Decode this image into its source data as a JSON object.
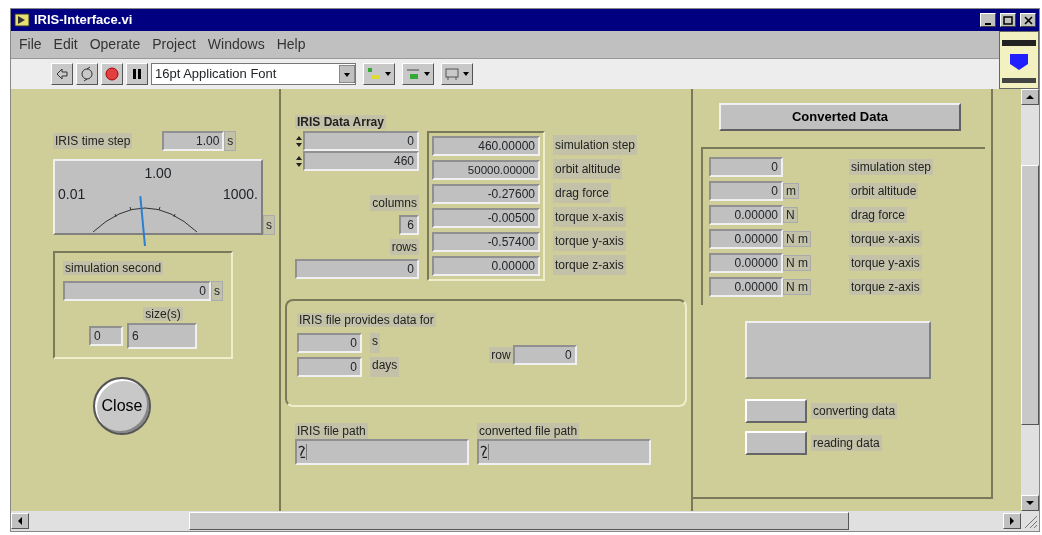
{
  "window": {
    "title": "IRIS-Interface.vi"
  },
  "menu": [
    "File",
    "Edit",
    "Operate",
    "Project",
    "Windows",
    "Help"
  ],
  "toolbar": {
    "font": "16pt Application Font"
  },
  "time_step": {
    "label": "IRIS time step",
    "value": "1.00",
    "unit": "s"
  },
  "meter": {
    "min": "0.01",
    "mid": "1.00",
    "max": "1000.",
    "unit": "s",
    "level": 0.47
  },
  "simulation_second": {
    "label": "simulation second",
    "value": "0",
    "unit": "s",
    "size_label": "size(s)",
    "index": "0",
    "size": "6"
  },
  "close_button": "Close",
  "data_array": {
    "label": "IRIS Data Array",
    "indices": [
      "0",
      "460"
    ],
    "columns_label": "columns",
    "columns": "6",
    "rows_label": "rows",
    "rows": "0",
    "elements": [
      {
        "value": "460.00000",
        "label": "simulation step"
      },
      {
        "value": "50000.00000",
        "label": "orbit altitude"
      },
      {
        "value": "-0.27600",
        "label": "drag force"
      },
      {
        "value": "-0.00500",
        "label": "torque x-axis"
      },
      {
        "value": "-0.57400",
        "label": "torque y-axis"
      },
      {
        "value": "0.00000",
        "label": "torque z-axis"
      }
    ]
  },
  "file_info": {
    "label": "IRIS file provides data for",
    "seconds": "0",
    "seconds_unit": "s",
    "days": "0",
    "days_unit": "days",
    "row_label": "row",
    "row": "0"
  },
  "paths": [
    {
      "label": "IRIS file path"
    },
    {
      "label": "converted file path"
    }
  ],
  "converted": {
    "button": "Converted Data",
    "rows": [
      {
        "value": "0",
        "label": "simulation step"
      },
      {
        "value": "0",
        "unit": "m",
        "label": "orbit altitude"
      },
      {
        "value": "0.00000",
        "unit": "N",
        "label": "drag force"
      },
      {
        "value": "0.00000",
        "unit": "N m",
        "label": "torque x-axis"
      },
      {
        "value": "0.00000",
        "unit": "N m",
        "label": "torque y-axis"
      },
      {
        "value": "0.00000",
        "unit": "N m",
        "label": "torque z-axis"
      }
    ],
    "leds": [
      {
        "label": "converting data",
        "on": false
      },
      {
        "label": "reading data",
        "on": false
      }
    ]
  }
}
